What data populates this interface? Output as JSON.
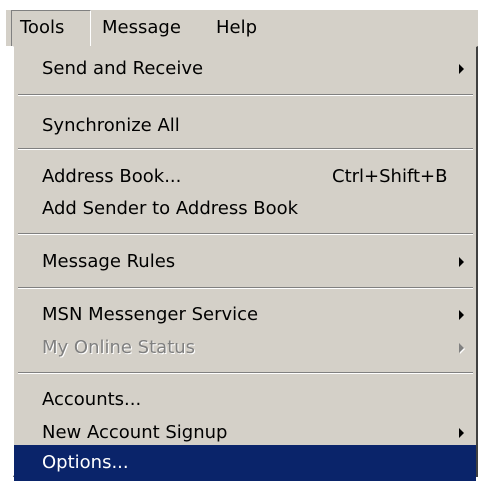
{
  "menubar": {
    "items": [
      {
        "label": "Tools"
      },
      {
        "label": "Message"
      },
      {
        "label": "Help"
      }
    ],
    "active": "Tools"
  },
  "dropdown": {
    "items": [
      {
        "label": "Send and Receive",
        "submenu": true
      },
      {
        "label": "Synchronize All"
      },
      {
        "label": "Address Book...",
        "accelerator": "Ctrl+Shift+B"
      },
      {
        "label": "Add Sender to Address Book"
      },
      {
        "label": "Message Rules",
        "submenu": true
      },
      {
        "label": "MSN Messenger Service",
        "submenu": true
      },
      {
        "label": "My Online Status",
        "submenu": true,
        "disabled": true
      },
      {
        "label": "Accounts..."
      },
      {
        "label": "New Account Signup",
        "submenu": true
      },
      {
        "label": "Options...",
        "selected": true
      }
    ]
  },
  "colors": {
    "menu_face": "#d4d0c8",
    "highlight": "#0a246a",
    "highlight_text": "#ffffff",
    "disabled_text": "#808080"
  }
}
